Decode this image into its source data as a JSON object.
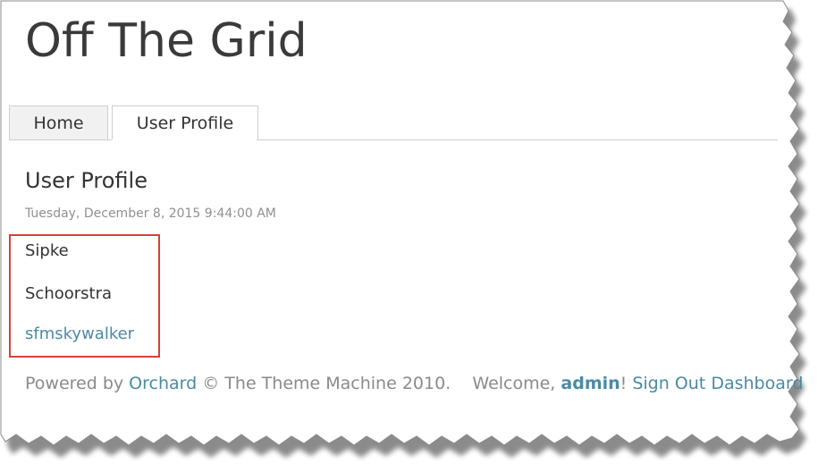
{
  "site": {
    "title": "Off The Grid"
  },
  "tabs": [
    {
      "label": "Home"
    },
    {
      "label": "User Profile"
    }
  ],
  "content": {
    "heading": "User Profile",
    "date": "Tuesday, December 8, 2015 9:44:00 AM",
    "first_name": "Sipke",
    "last_name": "Schoorstra",
    "username": "sfmskywalker"
  },
  "footer": {
    "powered_by": "Powered by",
    "orchard_link": "Orchard",
    "copyright": "© The Theme Machine 2010.",
    "welcome": "Welcome,",
    "admin_name": "admin",
    "exclaim": "!",
    "sign_out": "Sign Out",
    "dashboard": "Dashboard"
  },
  "colors": {
    "link": "#4a8aa3",
    "highlight_border": "#d9403a",
    "title": "#3a3a3a"
  }
}
